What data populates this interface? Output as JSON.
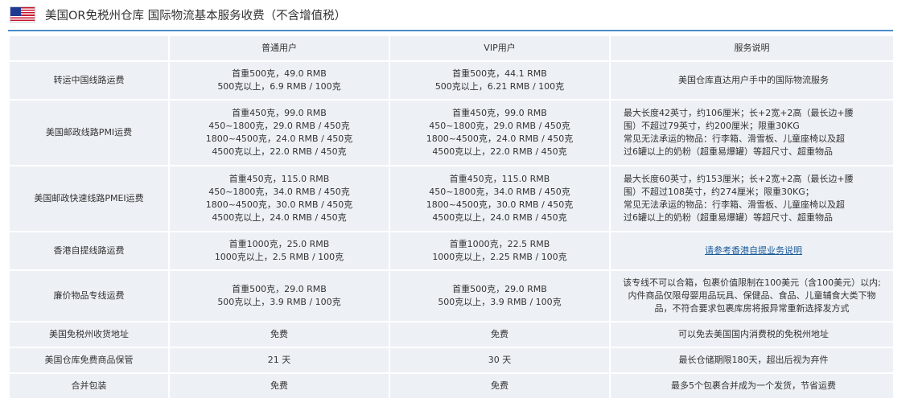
{
  "header": {
    "title": "美国OR免税州仓库  国际物流基本服务收费（不含增值税）",
    "flag_colors": {
      "red": "#c8102e",
      "white": "#ffffff",
      "blue": "#1f3a93"
    }
  },
  "table": {
    "columns": [
      "",
      "普通用户",
      "VIP用户",
      "服务说明"
    ],
    "rows": [
      {
        "name": "转运中国线路运费",
        "regular": [
          "首重500克，49.0 RMB",
          "500克以上，6.9 RMB / 100克"
        ],
        "vip": [
          "首重500克，44.1 RMB",
          "500克以上，6.21 RMB / 100克"
        ],
        "desc": [
          "美国仓库直达用户手中的国际物流服务"
        ]
      },
      {
        "name": "美国邮政线路PMI运费",
        "regular": [
          "首重450克，99.0 RMB",
          "450~1800克，29.0 RMB / 450克",
          "1800~4500克，24.0 RMB / 450克",
          "4500克以上，22.0 RMB / 450克"
        ],
        "vip": [
          "首重450克，99.0 RMB",
          "450~1800克，29.0 RMB / 450克",
          "1800~4500克，24.0 RMB / 450克",
          "4500克以上，22.0 RMB / 450克"
        ],
        "desc": [
          "最大长度42英寸，约106厘米；长+2宽+2高（最长边+腰",
          "围）不超过79英寸，约200厘米；限重30KG",
          "常见无法承运的物品：行李箱、滑雪板、儿童座椅以及超",
          "过6罐以上的奶粉（超重易爆罐）等超尺寸、超重物品"
        ]
      },
      {
        "name": "美国邮政快速线路PMEI运费",
        "regular": [
          "首重450克，115.0 RMB",
          "450~1800克，34.0 RMB / 450克",
          "1800~4500克，30.0 RMB / 450克",
          "4500克以上，24.0 RMB / 450克"
        ],
        "vip": [
          "首重450克，115.0 RMB",
          "450~1800克，34.0 RMB / 450克",
          "1800~4500克，30.0 RMB / 450克",
          "4500克以上，24.0 RMB / 450克"
        ],
        "desc": [
          "最大长度60英寸，约153厘米；长+2宽+2高（最长边+腰",
          "围）不超过108英寸，约274厘米；限重30KG；",
          "常见无法承运的物品：行李箱、滑雪板、儿童座椅以及超",
          "过6罐以上的奶粉（超重易爆罐）等超尺寸、超重物品"
        ]
      },
      {
        "name": "香港自提线路运费",
        "regular": [
          "首重1000克，25.0 RMB",
          "1000克以上，2.5 RMB / 100克"
        ],
        "vip": [
          "首重1000克，22.5 RMB",
          "1000克以上，2.25 RMB / 100克"
        ],
        "desc_link": "请参考香港自提业务说明"
      },
      {
        "name": "廉价物品专线运费",
        "regular": [
          "首重500克，29.0 RMB",
          "500克以上，3.9 RMB / 100克"
        ],
        "vip": [
          "首重500克，29.0 RMB",
          "500克以上，3.9 RMB / 100克"
        ],
        "desc": [
          "该专线不可以合箱，包裹价值限制在100美元（含100美元）以内;",
          "内件商品仅限母婴用品玩具、保健品、食品、儿童辅食大类下物",
          "品，不符合要求包裹库房将报异常重新选择发方式"
        ]
      },
      {
        "name": "美国免税州收货地址",
        "regular": [
          "免费"
        ],
        "vip": [
          "免费"
        ],
        "desc": [
          "可以免去美国国内消费税的免税州地址"
        ]
      },
      {
        "name": "美国仓库免费商品保管",
        "regular": [
          "21 天"
        ],
        "vip": [
          "30 天"
        ],
        "desc": [
          "最长仓储期限180天，超出后视为弃件"
        ]
      },
      {
        "name": "合并包装",
        "regular": [
          "免费"
        ],
        "vip": [
          "免费"
        ],
        "desc": [
          "最多5个包裹合并成为一个发货，节省运费"
        ]
      }
    ]
  },
  "colors": {
    "cell_bg": "#edf1f5",
    "rule": "#4a8dcc",
    "link": "#1a5a9a"
  }
}
